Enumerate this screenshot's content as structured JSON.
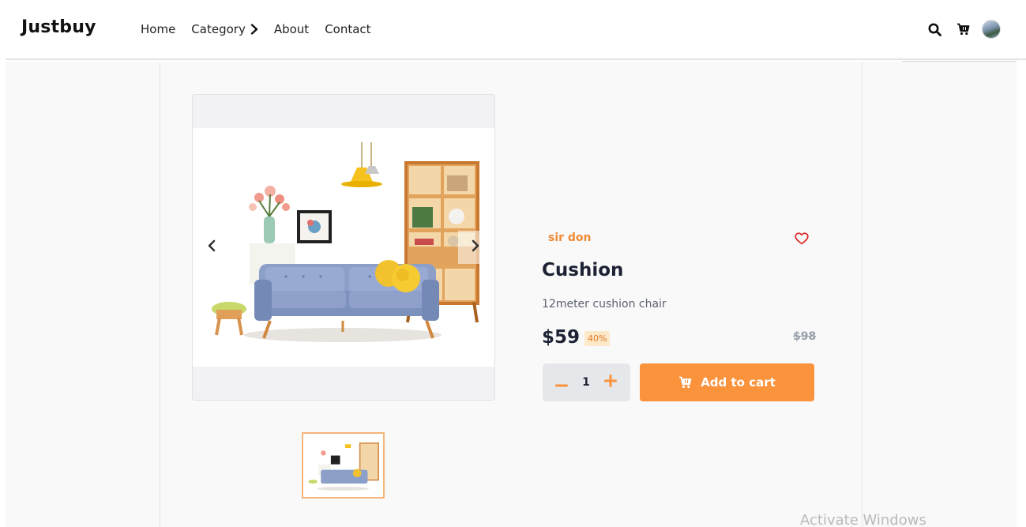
{
  "header": {
    "brand": "Justbuy",
    "nav": [
      "Home",
      "Category",
      "About",
      "Contact"
    ],
    "icons": [
      "search-icon",
      "cart-icon",
      "avatar"
    ]
  },
  "gallery": {
    "image": "living-room-furniture-photo",
    "prev_icon": "chevron-left-icon",
    "next_icon": "chevron-right-icon",
    "thumbnail_count": 1
  },
  "product": {
    "seller": "sir don",
    "title": "Cushion",
    "description": "12meter cushion chair",
    "price": "$59",
    "discount": "40%",
    "old_price": "$98",
    "quantity": "1",
    "add_to_cart_label": "Add to cart"
  },
  "colors": {
    "accent": "#fb923c",
    "seller": "#f08a34",
    "heart": "#dc2626",
    "discount_bg": "#fde9c9"
  },
  "watermark": "Activate Windows"
}
